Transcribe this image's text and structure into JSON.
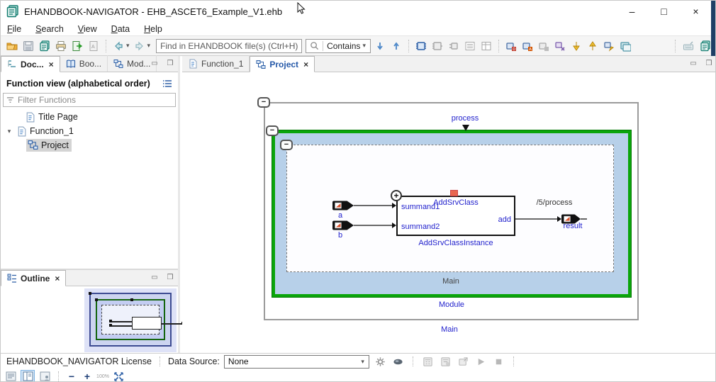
{
  "window": {
    "title": "EHANDBOOK-NAVIGATOR - EHB_ASCET6_Example_V1.ehb"
  },
  "glyphs": {
    "minimize": "–",
    "maximize": "□",
    "close": "×",
    "tab_close": "×",
    "caret": "▾",
    "tree_expanded": "▾",
    "panel_min": "▭",
    "panel_max": "❒",
    "minus": "−",
    "plus": "+"
  },
  "menu": {
    "items": [
      "File",
      "Search",
      "View",
      "Data",
      "Help"
    ]
  },
  "toolbar": {
    "search_placeholder": "Find in EHANDBOOK file(s) (Ctrl+H)",
    "contains": "Contains"
  },
  "left_panel": {
    "tabs": [
      "Doc...",
      "Boo...",
      "Mod..."
    ],
    "header": "Function view (alphabetical order)",
    "filter_placeholder": "Filter Functions",
    "tree": [
      "Title Page",
      "Function_1",
      "Project"
    ]
  },
  "outline_tab": "Outline",
  "editor": {
    "tabs": [
      "Function_1",
      "Project"
    ]
  },
  "diagram": {
    "process": "process",
    "class_name": "AddSrvClass",
    "instance": "AddSrvClassInstance",
    "summand1": "summand1",
    "summand2": "summand2",
    "add": "add",
    "a": "a",
    "b": "b",
    "result": "result",
    "ref": "/5/process",
    "main_inner": "Main",
    "module": "Module",
    "main_outer": "Main"
  },
  "status": {
    "license": "EHANDBOOK_NAVIGATOR License",
    "data_source_label": "Data Source:",
    "data_source_value": "None",
    "zoom_pct": "100%"
  },
  "colors": {
    "accent_blue": "#2323cd",
    "green_border": "#0aa50a",
    "module_fill": "#b7d0e9",
    "edge_strip": "#1e3f66",
    "active_tab_text": "#2458a8"
  }
}
